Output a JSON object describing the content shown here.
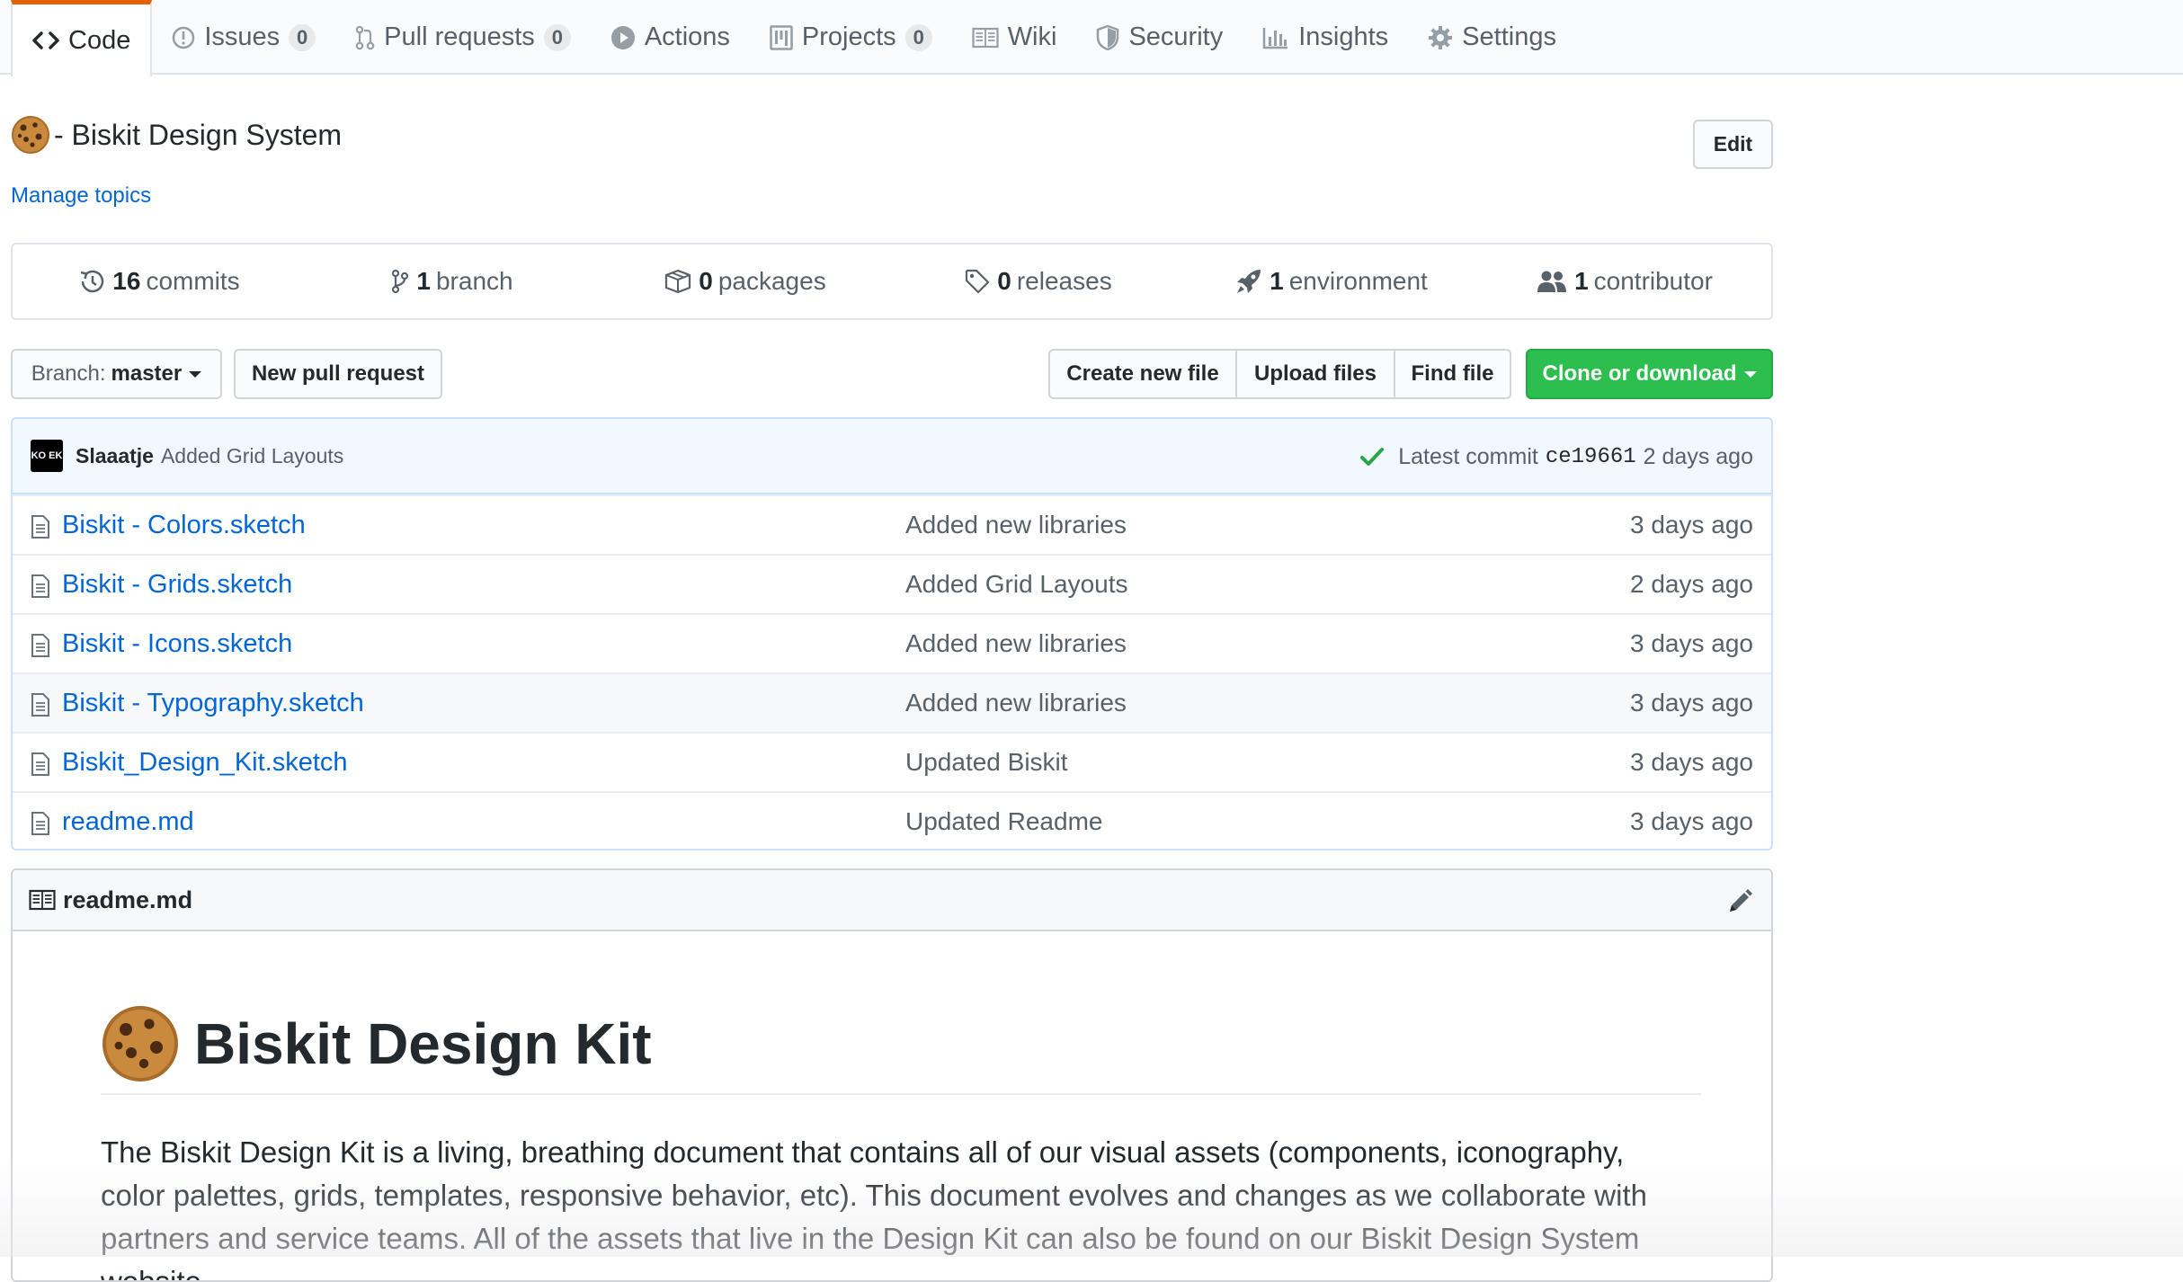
{
  "tabs": [
    {
      "label": "Code",
      "icon": "code-icon",
      "selected": true
    },
    {
      "label": "Issues",
      "count": "0",
      "icon": "issue-opened-icon"
    },
    {
      "label": "Pull requests",
      "count": "0",
      "icon": "git-pull-request-icon"
    },
    {
      "label": "Actions",
      "icon": "play-icon"
    },
    {
      "label": "Projects",
      "count": "0",
      "icon": "project-icon"
    },
    {
      "label": "Wiki",
      "icon": "book-icon"
    },
    {
      "label": "Security",
      "icon": "shield-icon"
    },
    {
      "label": "Insights",
      "icon": "graph-icon"
    },
    {
      "label": "Settings",
      "icon": "gear-icon"
    }
  ],
  "repo": {
    "description": "- Biskit Design System",
    "manage_topics": "Manage topics",
    "edit_label": "Edit"
  },
  "summary": {
    "commits": {
      "num": "16",
      "label": "commits"
    },
    "branches": {
      "num": "1",
      "label": "branch"
    },
    "packages": {
      "num": "0",
      "label": "packages"
    },
    "releases": {
      "num": "0",
      "label": "releases"
    },
    "environments": {
      "num": "1",
      "label": "environment"
    },
    "contributors": {
      "num": "1",
      "label": "contributor"
    }
  },
  "toolbar": {
    "branch_prefix": "Branch:",
    "branch_name": "master",
    "new_pull_request": "New pull request",
    "create_new_file": "Create new file",
    "upload_files": "Upload files",
    "find_file": "Find file",
    "clone_or_download": "Clone or download"
  },
  "latest_commit": {
    "avatar_text": "KO EK",
    "author": "Slaaatje",
    "message": "Added Grid Layouts",
    "label": "Latest commit",
    "sha": "ce19661",
    "age": "2 days ago"
  },
  "files": [
    {
      "name": "Biskit - Colors.sketch",
      "message": "Added new libraries",
      "age": "3 days ago"
    },
    {
      "name": "Biskit - Grids.sketch",
      "message": "Added Grid Layouts",
      "age": "2 days ago"
    },
    {
      "name": "Biskit - Icons.sketch",
      "message": "Added new libraries",
      "age": "3 days ago"
    },
    {
      "name": "Biskit - Typography.sketch",
      "message": "Added new libraries",
      "age": "3 days ago"
    },
    {
      "name": "Biskit_Design_Kit.sketch",
      "message": "Updated Biskit",
      "age": "3 days ago"
    },
    {
      "name": "readme.md",
      "message": "Updated Readme",
      "age": "3 days ago"
    }
  ],
  "readme": {
    "filename": "readme.md",
    "title": "Biskit Design Kit",
    "paragraph": "The Biskit Design Kit is a living, breathing document that contains all of our visual assets (components, iconography, color palettes, grids, templates, responsive behavior, etc). This document evolves and changes as we collaborate with partners and service teams. All of the assets that live in the Design Kit can also be found on our Biskit Design System website."
  },
  "colors": {
    "link": "#0366d6",
    "accent_tab": "#e36209",
    "clone_button": "#2cbe4e",
    "commit_bg": "#f1f8ff",
    "check": "#28a745"
  }
}
